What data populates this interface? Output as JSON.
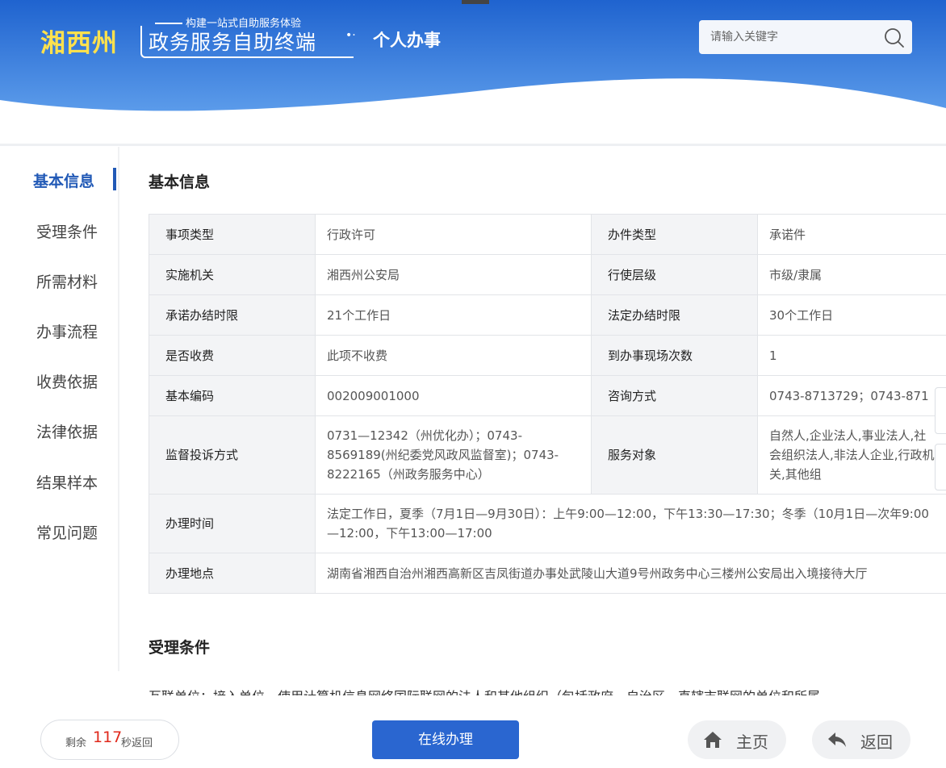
{
  "header": {
    "region": "湘西州",
    "slogan": "构建一站式自助服务体验",
    "system_name": "政务服务自助终端",
    "page_title": "个人办事",
    "search_placeholder": "请输入关键字"
  },
  "sidebar": {
    "items": [
      {
        "label": "基本信息",
        "active": true
      },
      {
        "label": "受理条件"
      },
      {
        "label": "所需材料"
      },
      {
        "label": "办事流程"
      },
      {
        "label": "收费依据"
      },
      {
        "label": "法律依据"
      },
      {
        "label": "结果样本"
      },
      {
        "label": "常见问题"
      }
    ]
  },
  "basic_info": {
    "title": "基本信息",
    "rows": [
      {
        "k1": "事项类型",
        "v1": "行政许可",
        "k2": "办件类型",
        "v2": "承诺件"
      },
      {
        "k1": "实施机关",
        "v1": "湘西州公安局",
        "k2": "行使层级",
        "v2": "市级/隶属"
      },
      {
        "k1": "承诺办结时限",
        "v1": "21个工作日",
        "k2": "法定办结时限",
        "v2": "30个工作日"
      },
      {
        "k1": "是否收费",
        "v1": "此项不收费",
        "k2": "到办事现场次数",
        "v2": "1"
      },
      {
        "k1": "基本编码",
        "v1": "002009001000",
        "k2": "咨询方式",
        "v2": "0743-8713729；0743-871"
      },
      {
        "k1": "监督投诉方式",
        "v1": "0731—12342（州优化办）；0743-8569189(州纪委党风政风监督室)；0743-8222165（州政务服务中心）",
        "k2": "服务对象",
        "v2": "自然人,企业法人,事业法人,社会组织法人,非法人企业,行政机关,其他组"
      }
    ],
    "office_hours_label": "办理时间",
    "office_hours": "法定工作日，夏季（7月1日—9月30日）：上午9:00—12:00，下午13:30—17:30；冬季（10月1日—次年9:00—12:00，下午13:00—17:00",
    "location_label": "办理地点",
    "location": "湖南省湘西自治州湘西高新区吉凤街道办事处武陵山大道9号州政务中心三楼州公安局出入境接待大厅"
  },
  "conditions": {
    "title": "受理条件",
    "text_preview": "互联单位：接入单位，使用计算机信息网络国际联网的法人和其他组织（包括政府、自治区、直辖市联网的单位和所属"
  },
  "footer": {
    "countdown_prefix": "剩余",
    "countdown_seconds": "117",
    "countdown_suffix": "秒返回",
    "online_button": "在线办理",
    "home_button": "主页",
    "back_button": "返回"
  },
  "colors": {
    "brand_blue": "#2a66d0",
    "header_blue": "#3a7fe0",
    "accent_yellow": "#ffe14d",
    "countdown_red": "#e0291c"
  }
}
